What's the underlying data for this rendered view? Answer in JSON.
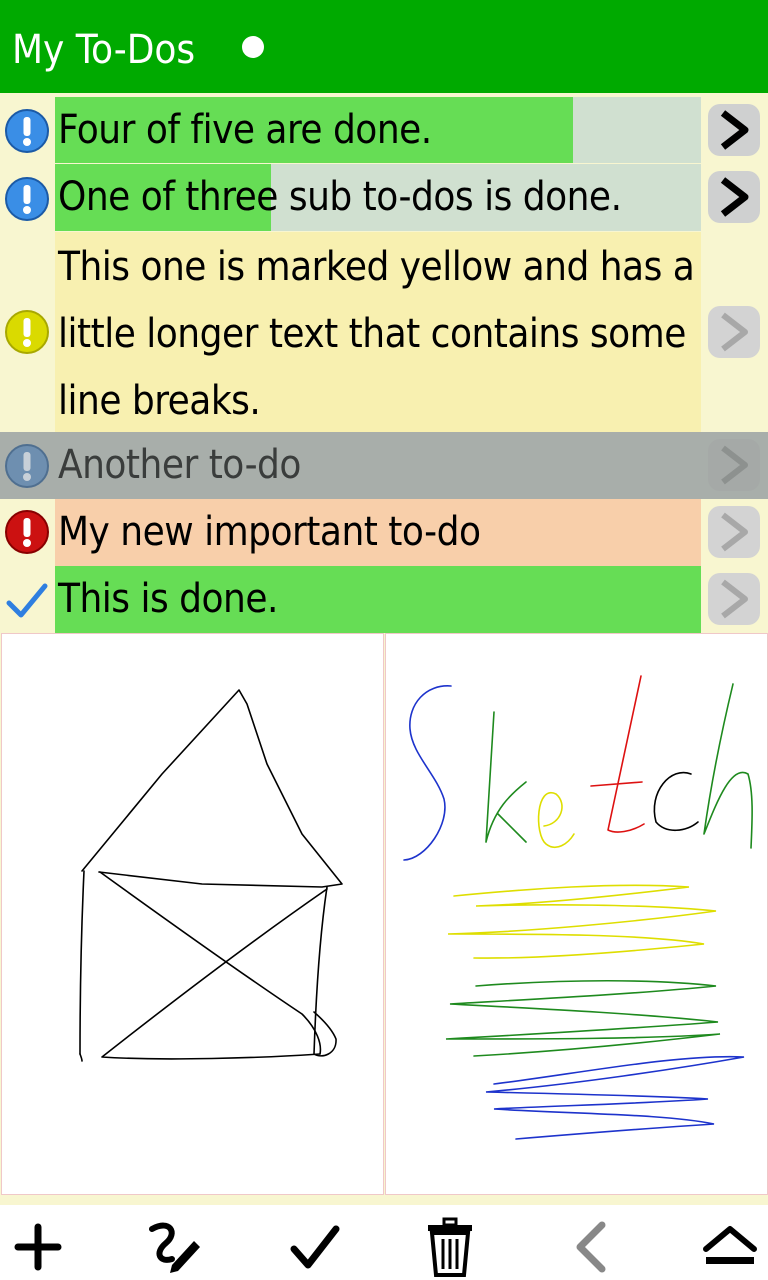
{
  "header": {
    "title": "My To-Dos"
  },
  "todos": [
    {
      "text": "Four of five are done.",
      "progress": 0.8,
      "icon": "info-blue",
      "arrow": "dark"
    },
    {
      "text": "One of three sub to-dos is done.",
      "progress": 0.33,
      "icon": "info-blue",
      "arrow": "dark"
    },
    {
      "text": "This one is marked yellow and has a little longer text that contains some line breaks.",
      "icon": "info-yellow",
      "arrow": "light"
    },
    {
      "text": "Another to-do",
      "icon": "info-blue",
      "arrow": "light"
    },
    {
      "text": "My new important to-do",
      "icon": "important-red",
      "arrow": "light"
    },
    {
      "text": "This is done.",
      "icon": "checkmark",
      "arrow": "light"
    }
  ],
  "toolbar": {
    "buttons": [
      "add-icon",
      "sketch-icon",
      "checkmark-icon",
      "trash-icon",
      "back-icon",
      "eject-icon"
    ]
  },
  "colors": {
    "header": "#00aa00",
    "progress_green": "#66dd55",
    "progress_gray": "#d0e0d0",
    "yellow_item": "#f8f0b0",
    "gray_item": "#a8aeaa",
    "orange_item": "#f8cfaa"
  }
}
